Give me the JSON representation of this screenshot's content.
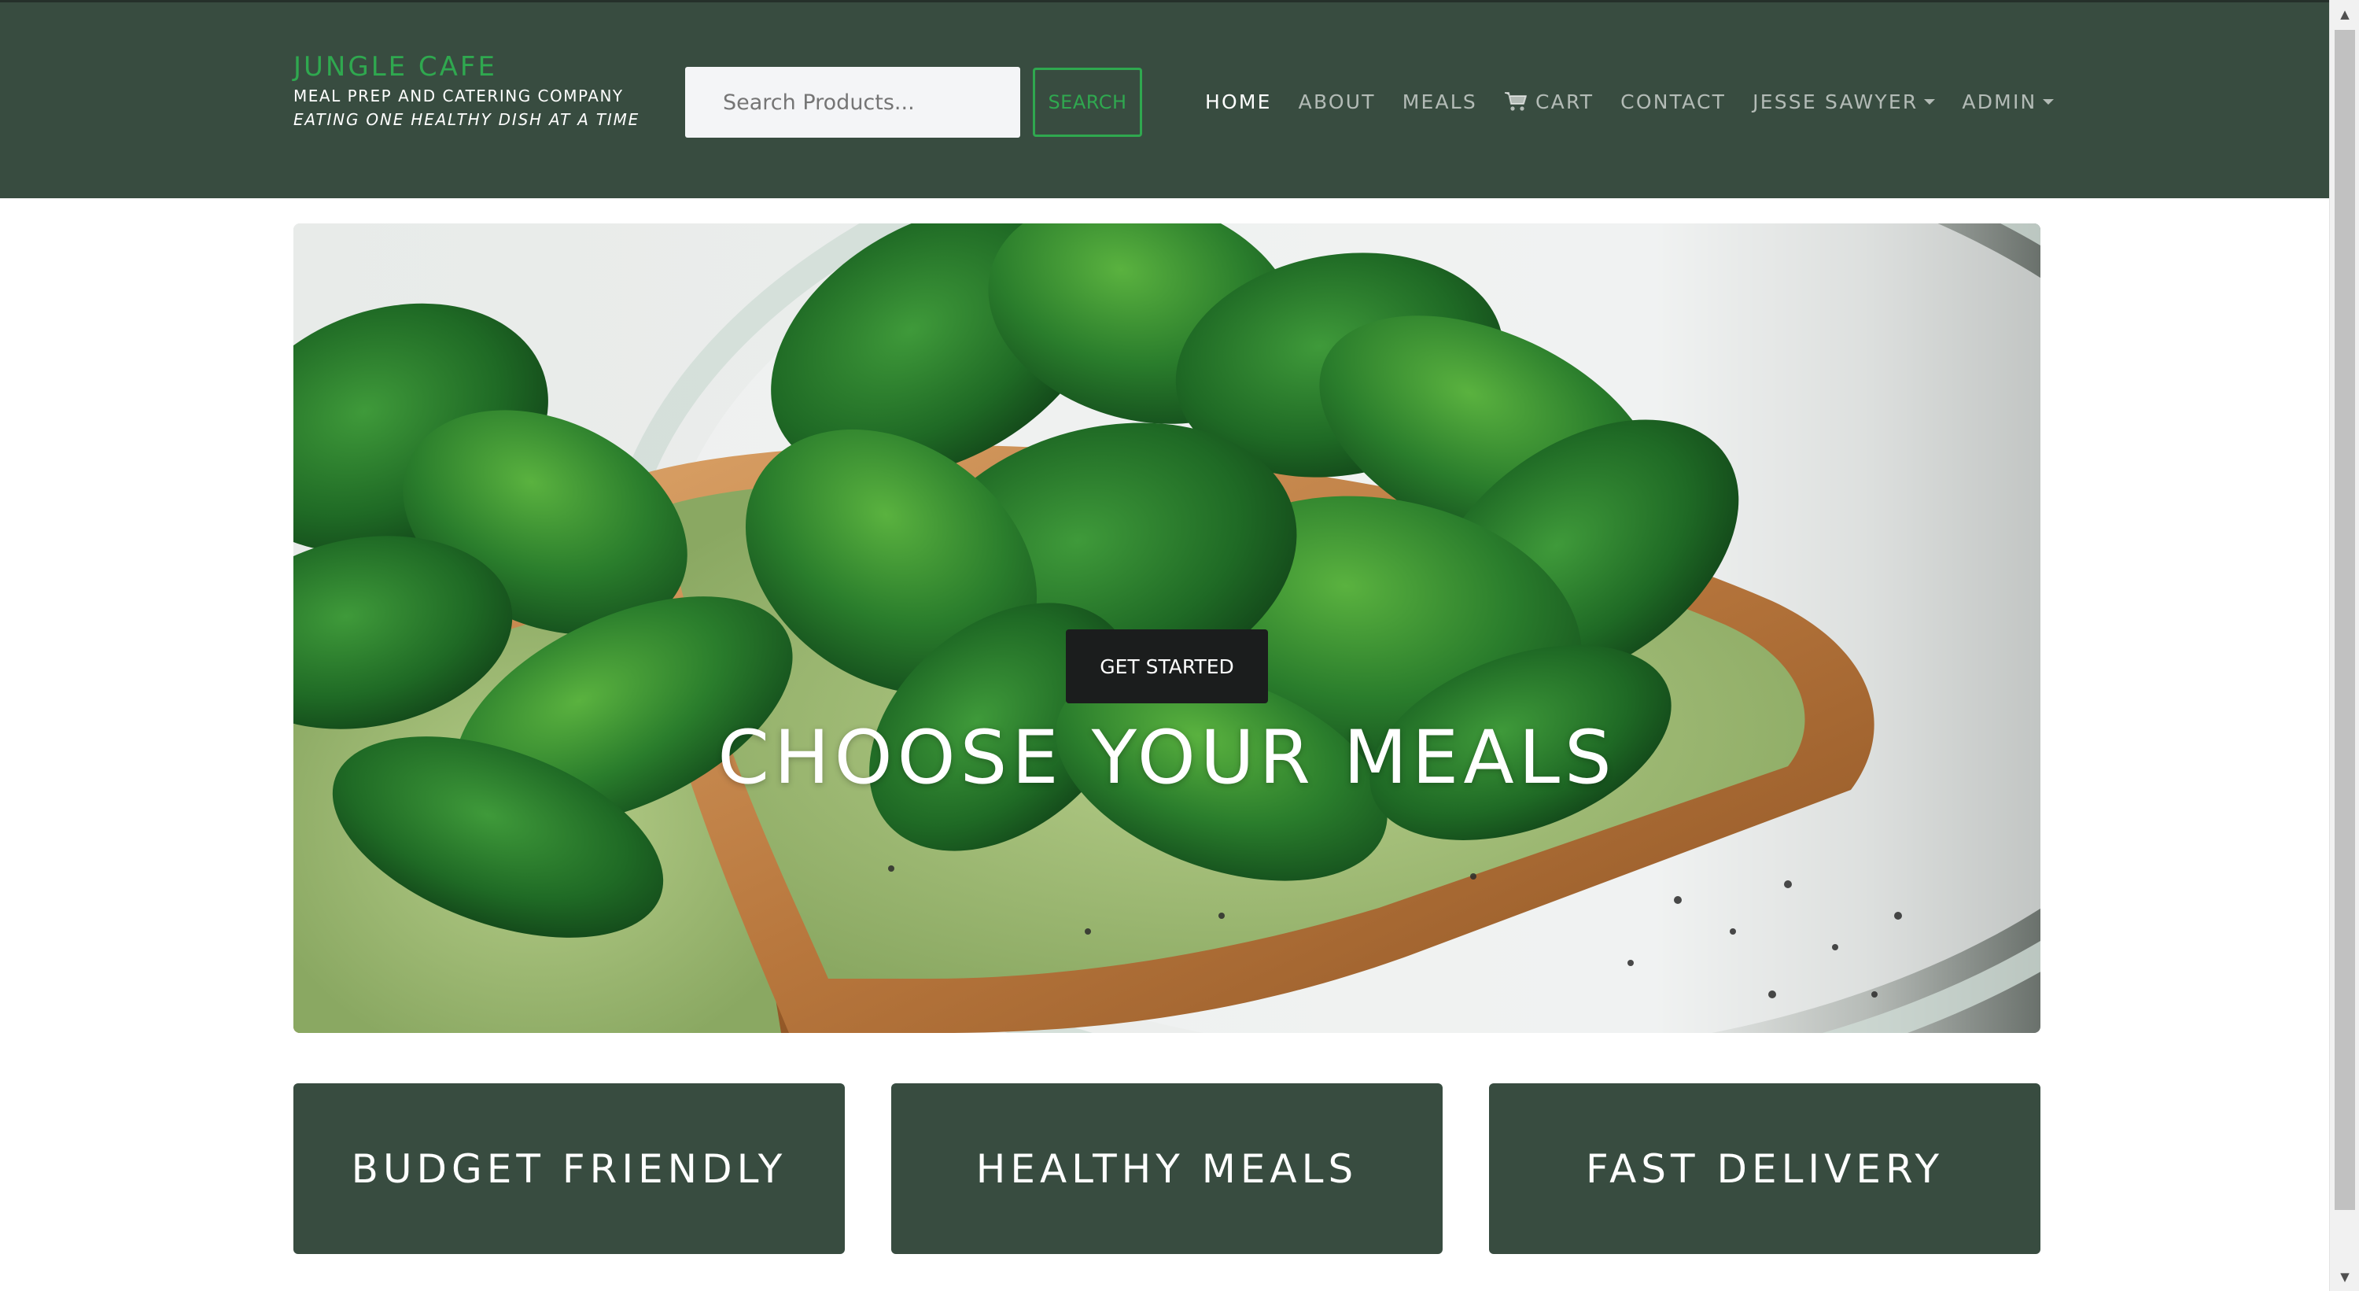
{
  "brand": {
    "name": "JUNGLE CAFE",
    "tagline": "MEAL PREP AND CATERING COMPANY",
    "slogan": "EATING ONE HEALTHY DISH AT A TIME",
    "color": "#2fa84f"
  },
  "search": {
    "placeholder": "Search Products...",
    "value": "",
    "button_label": "SEARCH"
  },
  "nav": {
    "items": [
      {
        "label": "HOME",
        "active": true
      },
      {
        "label": "ABOUT"
      },
      {
        "label": "MEALS"
      },
      {
        "label": "CART",
        "icon": "cart-icon"
      },
      {
        "label": "CONTACT"
      },
      {
        "label": "JESSE SAWYER",
        "dropdown": true
      },
      {
        "label": "ADMIN",
        "dropdown": true
      }
    ]
  },
  "hero": {
    "title": "CHOOSE YOUR MEALS",
    "button_label": "GET STARTED",
    "image": "spinach-avocado-toast-photo"
  },
  "features": [
    {
      "label": "BUDGET FRIENDLY"
    },
    {
      "label": "HEALTHY MEALS"
    },
    {
      "label": "FAST DELIVERY"
    }
  ],
  "colors": {
    "navbar": "#384c40",
    "card": "#384c40",
    "button_dark": "#1b1d1d"
  }
}
